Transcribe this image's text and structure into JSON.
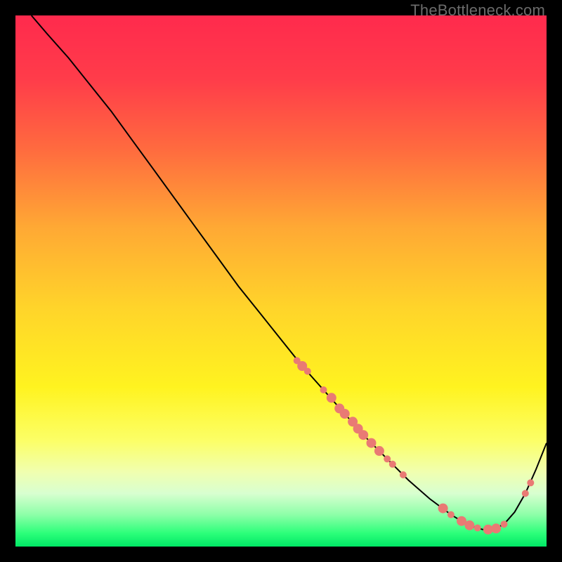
{
  "watermark": "TheBottleneck.com",
  "chart_data": {
    "type": "line",
    "title": "",
    "xlabel": "",
    "ylabel": "",
    "xlim": [
      0,
      100
    ],
    "ylim": [
      0,
      100
    ],
    "grid": false,
    "legend": false,
    "gradient_stops": [
      {
        "offset": 0.0,
        "color": "#ff2a4d"
      },
      {
        "offset": 0.12,
        "color": "#ff3c4a"
      },
      {
        "offset": 0.25,
        "color": "#ff6a3f"
      },
      {
        "offset": 0.4,
        "color": "#ffa934"
      },
      {
        "offset": 0.55,
        "color": "#ffd42a"
      },
      {
        "offset": 0.7,
        "color": "#fff320"
      },
      {
        "offset": 0.8,
        "color": "#fcff66"
      },
      {
        "offset": 0.86,
        "color": "#f0ffb0"
      },
      {
        "offset": 0.9,
        "color": "#d8ffd0"
      },
      {
        "offset": 0.94,
        "color": "#8dffa8"
      },
      {
        "offset": 0.975,
        "color": "#2cff7a"
      },
      {
        "offset": 1.0,
        "color": "#00e765"
      }
    ],
    "series": [
      {
        "name": "bottleneck-curve",
        "color": "#000000",
        "width": 2.0,
        "x": [
          3,
          6,
          10,
          14,
          18,
          22,
          26,
          30,
          34,
          38,
          42,
          46,
          50,
          54,
          58,
          62,
          66,
          70,
          74,
          78,
          82,
          84,
          86,
          88,
          90,
          92,
          94,
          96,
          98,
          100
        ],
        "y": [
          100,
          96.5,
          92,
          87,
          82,
          76.5,
          71,
          65.5,
          60,
          54.5,
          49,
          44,
          39,
          34,
          29.5,
          25,
          20.5,
          16.5,
          12.5,
          9,
          6,
          4.8,
          3.8,
          3.2,
          3.2,
          4.2,
          6.5,
          10,
          14.5,
          19.5
        ]
      }
    ],
    "markers": {
      "color": "#e97a74",
      "radius_small": 5,
      "radius_large": 7,
      "points": [
        {
          "x": 53,
          "y": 35.0,
          "r": "small"
        },
        {
          "x": 54,
          "y": 34.0,
          "r": "large"
        },
        {
          "x": 55,
          "y": 33.0,
          "r": "small"
        },
        {
          "x": 58,
          "y": 29.5,
          "r": "small"
        },
        {
          "x": 59.5,
          "y": 28.0,
          "r": "large"
        },
        {
          "x": 61,
          "y": 26.0,
          "r": "large"
        },
        {
          "x": 62,
          "y": 25.0,
          "r": "large"
        },
        {
          "x": 63.5,
          "y": 23.5,
          "r": "large"
        },
        {
          "x": 64.5,
          "y": 22.2,
          "r": "large"
        },
        {
          "x": 65.5,
          "y": 21.0,
          "r": "large"
        },
        {
          "x": 67,
          "y": 19.5,
          "r": "large"
        },
        {
          "x": 68.5,
          "y": 18.0,
          "r": "large"
        },
        {
          "x": 70,
          "y": 16.5,
          "r": "small"
        },
        {
          "x": 71,
          "y": 15.5,
          "r": "small"
        },
        {
          "x": 73,
          "y": 13.5,
          "r": "small"
        },
        {
          "x": 80.5,
          "y": 7.2,
          "r": "large"
        },
        {
          "x": 82,
          "y": 6.0,
          "r": "small"
        },
        {
          "x": 84,
          "y": 4.8,
          "r": "large"
        },
        {
          "x": 85.5,
          "y": 4.0,
          "r": "large"
        },
        {
          "x": 87,
          "y": 3.5,
          "r": "small"
        },
        {
          "x": 89,
          "y": 3.2,
          "r": "large"
        },
        {
          "x": 90.5,
          "y": 3.4,
          "r": "large"
        },
        {
          "x": 92,
          "y": 4.2,
          "r": "small"
        },
        {
          "x": 96,
          "y": 10.0,
          "r": "small"
        },
        {
          "x": 97,
          "y": 12.0,
          "r": "small"
        }
      ]
    }
  }
}
